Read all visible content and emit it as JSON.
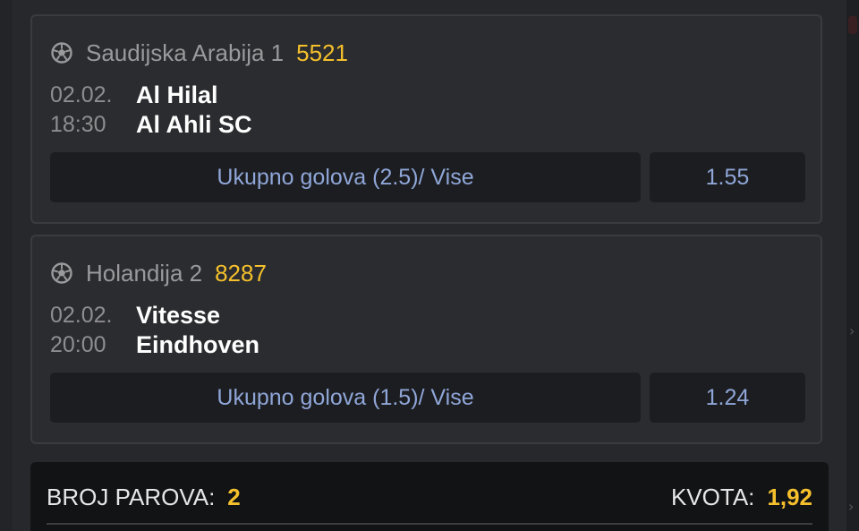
{
  "matches": [
    {
      "league": "Saudijska Arabija 1",
      "code": "5521",
      "date": "02.02.",
      "time": "18:30",
      "home": "Al Hilal",
      "away": "Al Ahli SC",
      "market": "Ukupno golova (2.5)/ Vise",
      "odd": "1.55",
      "icon": "soccer-ball-icon"
    },
    {
      "league": "Holandija 2",
      "code": "8287",
      "date": "02.02.",
      "time": "20:00",
      "home": "Vitesse",
      "away": "Eindhoven",
      "market": "Ukupno golova (1.5)/ Vise",
      "odd": "1.24",
      "icon": "soccer-ball-icon"
    }
  ],
  "summary": {
    "pairs_label": "BROJ PAROVA:",
    "pairs_value": "2",
    "odds_label": "KVOTA:",
    "odds_value": "1,92"
  },
  "colors": {
    "accent": "#f5c02c",
    "market_text": "#8fa6d8",
    "background": "#27282b"
  }
}
